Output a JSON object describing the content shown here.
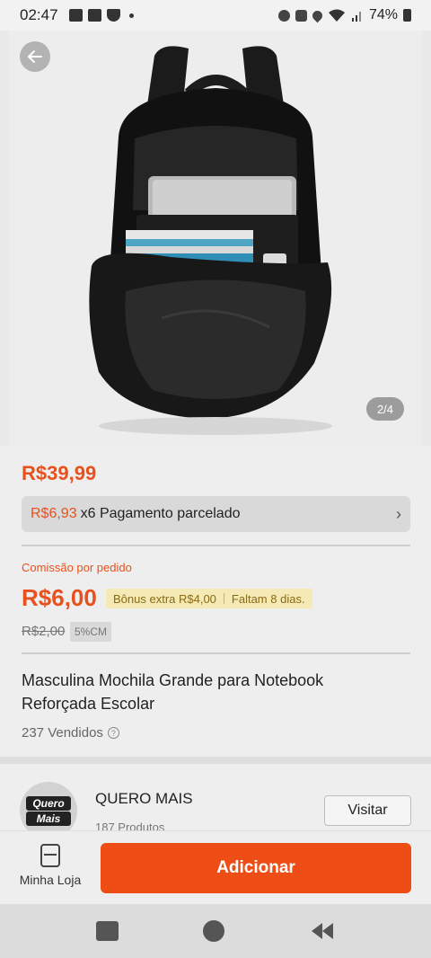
{
  "status_bar": {
    "time": "02:47",
    "battery": "74%",
    "icons": [
      "gallery-icon",
      "photo-icon",
      "shield-icon",
      "notification-dot",
      "alarm-icon",
      "mute-icon",
      "location-icon",
      "wifi-icon",
      "signal-icon",
      "battery-icon"
    ]
  },
  "product_gallery": {
    "counter": "2/4",
    "back_icon": "arrow-left-icon"
  },
  "pricing": {
    "price": "R$39,99",
    "installment_price": "R$6,93",
    "installment_text": "x6 Pagamento parcelado"
  },
  "commission": {
    "label": "Comissão por pedido",
    "amount": "R$6,00",
    "bonus": "Bônus extra R$4,00",
    "remaining": "Faltam 8 dias.",
    "old_amount": "R$2,00",
    "rate_badge": "5%CM"
  },
  "product": {
    "title": "Masculina Mochila Grande para Notebook Reforçada Escolar",
    "sold": "237 Vendidos"
  },
  "shop": {
    "logo_line1": "Quero",
    "logo_line2": "Mais",
    "name": "QUERO MAIS",
    "products": "187 Produtos",
    "visit_label": "Visitar"
  },
  "action_bar": {
    "my_store_label": "Minha Loja",
    "add_label": "Adicionar"
  },
  "colors": {
    "accent": "#ee4d16",
    "price": "#e8511d",
    "bonus_bg": "#f5eab6"
  }
}
